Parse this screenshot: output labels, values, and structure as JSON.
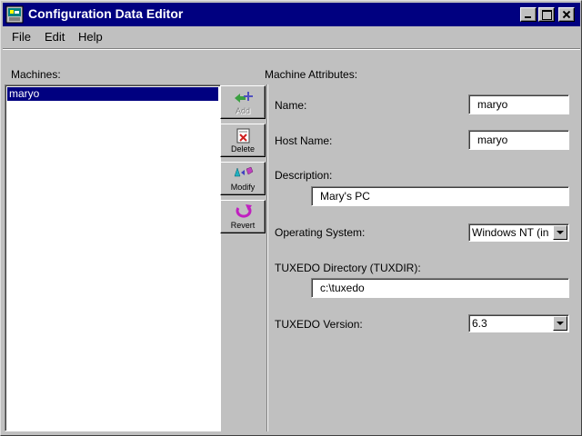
{
  "window": {
    "title": "Configuration Data Editor"
  },
  "menu": {
    "file": "File",
    "edit": "Edit",
    "help": "Help"
  },
  "machines": {
    "label": "Machines:",
    "items": [
      "maryo"
    ],
    "selected": "maryo"
  },
  "toolbar": {
    "add": "Add",
    "delete": "Delete",
    "modify": "Modify",
    "revert": "Revert"
  },
  "attributes": {
    "header": "Machine Attributes:",
    "name_label": "Name:",
    "name_value": "maryo",
    "host_label": "Host Name:",
    "host_value": "maryo",
    "description_label": "Description:",
    "description_value": "Mary's PC",
    "os_label": "Operating System:",
    "os_value": "Windows NT (in",
    "tuxdir_label": "TUXEDO Directory (TUXDIR):",
    "tuxdir_value": "c:\\tuxedo",
    "version_label": "TUXEDO Version:",
    "version_value": "6.3"
  },
  "icons": {
    "app": "app-icon",
    "add": "add-arrow-icon",
    "delete": "delete-icon",
    "modify": "modify-icon",
    "revert": "revert-icon"
  },
  "colors": {
    "titlebar": "#000080",
    "selection": "#000080",
    "face": "#c0c0c0"
  }
}
